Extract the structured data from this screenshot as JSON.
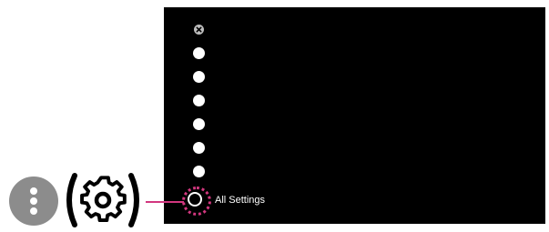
{
  "screen": {
    "menu": {
      "items": [
        {
          "icon": "close-icon"
        },
        {
          "icon": "menu-item-icon"
        },
        {
          "icon": "menu-item-icon"
        },
        {
          "icon": "menu-item-icon"
        },
        {
          "icon": "menu-item-icon"
        },
        {
          "icon": "menu-item-icon"
        },
        {
          "icon": "menu-item-icon"
        }
      ],
      "selected_item": {
        "label": "All Settings",
        "icon": "settings-icon"
      }
    }
  },
  "remote": {
    "buttons": [
      {
        "icon": "more-vertical-icon"
      },
      {
        "icon": "gear-icon"
      }
    ]
  },
  "colors": {
    "screen_background": "#000000",
    "highlight": "#d2377f",
    "remote_button": "#8c8c8c",
    "menu_dot": "#ffffff"
  }
}
